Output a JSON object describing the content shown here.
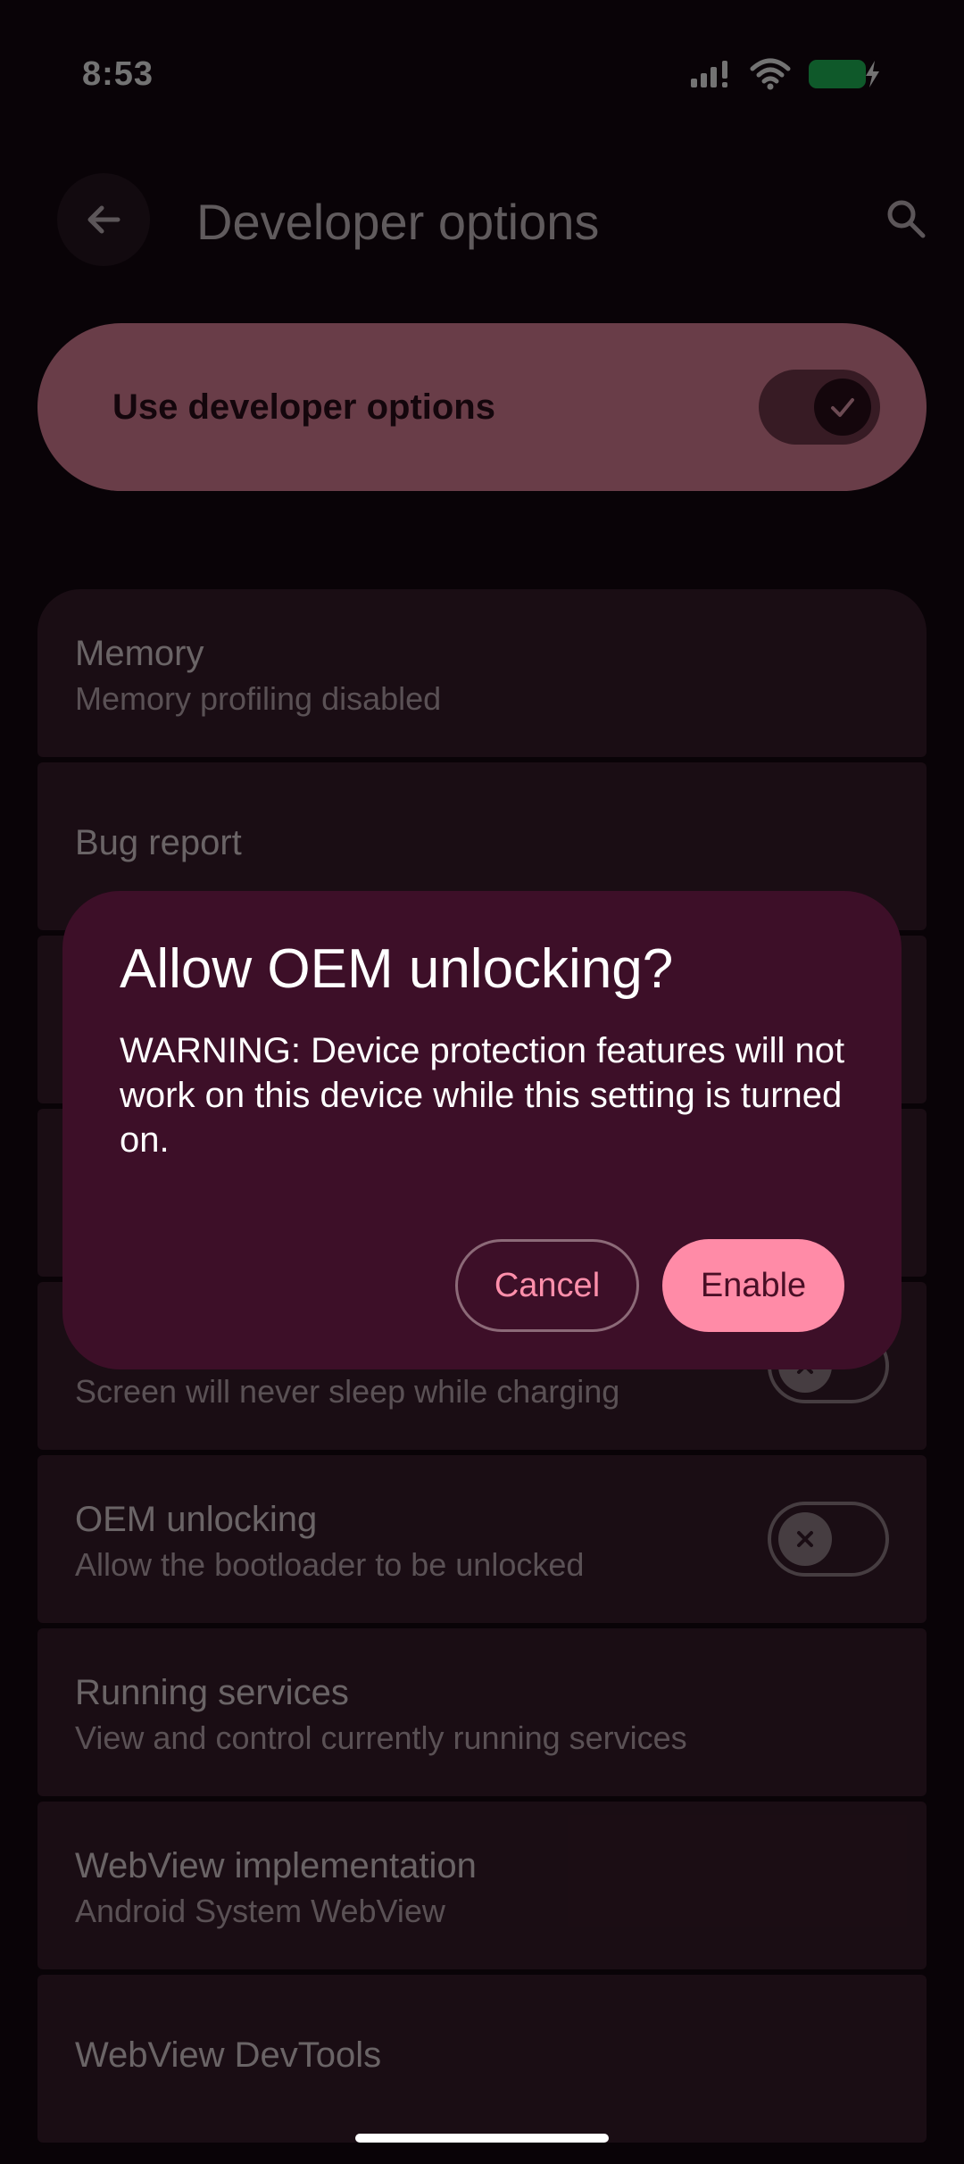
{
  "status_bar": {
    "time": "8:53"
  },
  "app_bar": {
    "title": "Developer options"
  },
  "master_toggle": {
    "label": "Use developer options",
    "checked": true
  },
  "settings": [
    {
      "title": "Memory",
      "subtitle": "Memory profiling disabled"
    },
    {
      "title": "Bug report",
      "subtitle": ""
    },
    {
      "title": "",
      "subtitle": ""
    },
    {
      "title": "",
      "subtitle": ""
    },
    {
      "title": "",
      "subtitle": "Screen will never sleep while charging",
      "toggle": false
    },
    {
      "title": "OEM unlocking",
      "subtitle": "Allow the bootloader to be unlocked",
      "toggle": false
    },
    {
      "title": "Running services",
      "subtitle": "View and control currently running services"
    },
    {
      "title": "WebView implementation",
      "subtitle": "Android System WebView"
    },
    {
      "title": "WebView DevTools",
      "subtitle": ""
    }
  ],
  "dialog": {
    "title": "Allow OEM unlocking?",
    "message": "WARNING: Device protection features will not work on this device while this setting is turned on.",
    "cancel_label": "Cancel",
    "confirm_label": "Enable"
  },
  "colors": {
    "accent": "#ff8ba7",
    "dialog_bg": "#3d0f28",
    "background": "#140710"
  }
}
